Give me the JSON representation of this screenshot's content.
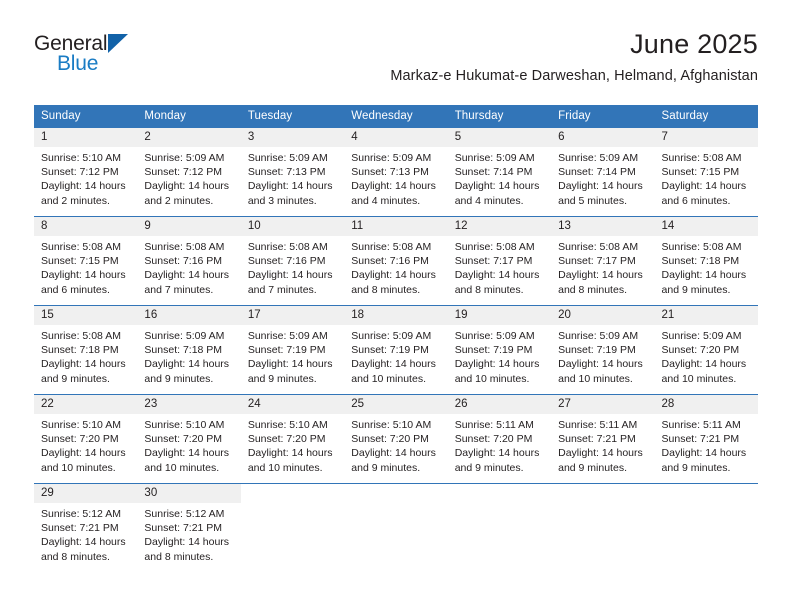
{
  "branding": {
    "logo_text_primary": "General",
    "logo_text_secondary": "Blue",
    "logo_icon": "triangle-flag-icon",
    "accent_color": "#1262a8"
  },
  "header": {
    "month_title": "June 2025",
    "location": "Markaz-e Hukumat-e Darweshan, Helmand, Afghanistan",
    "header_bar_color": "#3275b8",
    "daynum_band_color": "#f0f0f0"
  },
  "calendar": {
    "weekday_headers": [
      "Sunday",
      "Monday",
      "Tuesday",
      "Wednesday",
      "Thursday",
      "Friday",
      "Saturday"
    ],
    "weeks": [
      [
        {
          "day": "1",
          "sunrise": "Sunrise: 5:10 AM",
          "sunset": "Sunset: 7:12 PM",
          "daylight_line1": "Daylight: 14 hours",
          "daylight_line2": "and 2 minutes."
        },
        {
          "day": "2",
          "sunrise": "Sunrise: 5:09 AM",
          "sunset": "Sunset: 7:12 PM",
          "daylight_line1": "Daylight: 14 hours",
          "daylight_line2": "and 2 minutes."
        },
        {
          "day": "3",
          "sunrise": "Sunrise: 5:09 AM",
          "sunset": "Sunset: 7:13 PM",
          "daylight_line1": "Daylight: 14 hours",
          "daylight_line2": "and 3 minutes."
        },
        {
          "day": "4",
          "sunrise": "Sunrise: 5:09 AM",
          "sunset": "Sunset: 7:13 PM",
          "daylight_line1": "Daylight: 14 hours",
          "daylight_line2": "and 4 minutes."
        },
        {
          "day": "5",
          "sunrise": "Sunrise: 5:09 AM",
          "sunset": "Sunset: 7:14 PM",
          "daylight_line1": "Daylight: 14 hours",
          "daylight_line2": "and 4 minutes."
        },
        {
          "day": "6",
          "sunrise": "Sunrise: 5:09 AM",
          "sunset": "Sunset: 7:14 PM",
          "daylight_line1": "Daylight: 14 hours",
          "daylight_line2": "and 5 minutes."
        },
        {
          "day": "7",
          "sunrise": "Sunrise: 5:08 AM",
          "sunset": "Sunset: 7:15 PM",
          "daylight_line1": "Daylight: 14 hours",
          "daylight_line2": "and 6 minutes."
        }
      ],
      [
        {
          "day": "8",
          "sunrise": "Sunrise: 5:08 AM",
          "sunset": "Sunset: 7:15 PM",
          "daylight_line1": "Daylight: 14 hours",
          "daylight_line2": "and 6 minutes."
        },
        {
          "day": "9",
          "sunrise": "Sunrise: 5:08 AM",
          "sunset": "Sunset: 7:16 PM",
          "daylight_line1": "Daylight: 14 hours",
          "daylight_line2": "and 7 minutes."
        },
        {
          "day": "10",
          "sunrise": "Sunrise: 5:08 AM",
          "sunset": "Sunset: 7:16 PM",
          "daylight_line1": "Daylight: 14 hours",
          "daylight_line2": "and 7 minutes."
        },
        {
          "day": "11",
          "sunrise": "Sunrise: 5:08 AM",
          "sunset": "Sunset: 7:16 PM",
          "daylight_line1": "Daylight: 14 hours",
          "daylight_line2": "and 8 minutes."
        },
        {
          "day": "12",
          "sunrise": "Sunrise: 5:08 AM",
          "sunset": "Sunset: 7:17 PM",
          "daylight_line1": "Daylight: 14 hours",
          "daylight_line2": "and 8 minutes."
        },
        {
          "day": "13",
          "sunrise": "Sunrise: 5:08 AM",
          "sunset": "Sunset: 7:17 PM",
          "daylight_line1": "Daylight: 14 hours",
          "daylight_line2": "and 8 minutes."
        },
        {
          "day": "14",
          "sunrise": "Sunrise: 5:08 AM",
          "sunset": "Sunset: 7:18 PM",
          "daylight_line1": "Daylight: 14 hours",
          "daylight_line2": "and 9 minutes."
        }
      ],
      [
        {
          "day": "15",
          "sunrise": "Sunrise: 5:08 AM",
          "sunset": "Sunset: 7:18 PM",
          "daylight_line1": "Daylight: 14 hours",
          "daylight_line2": "and 9 minutes."
        },
        {
          "day": "16",
          "sunrise": "Sunrise: 5:09 AM",
          "sunset": "Sunset: 7:18 PM",
          "daylight_line1": "Daylight: 14 hours",
          "daylight_line2": "and 9 minutes."
        },
        {
          "day": "17",
          "sunrise": "Sunrise: 5:09 AM",
          "sunset": "Sunset: 7:19 PM",
          "daylight_line1": "Daylight: 14 hours",
          "daylight_line2": "and 9 minutes."
        },
        {
          "day": "18",
          "sunrise": "Sunrise: 5:09 AM",
          "sunset": "Sunset: 7:19 PM",
          "daylight_line1": "Daylight: 14 hours",
          "daylight_line2": "and 10 minutes."
        },
        {
          "day": "19",
          "sunrise": "Sunrise: 5:09 AM",
          "sunset": "Sunset: 7:19 PM",
          "daylight_line1": "Daylight: 14 hours",
          "daylight_line2": "and 10 minutes."
        },
        {
          "day": "20",
          "sunrise": "Sunrise: 5:09 AM",
          "sunset": "Sunset: 7:19 PM",
          "daylight_line1": "Daylight: 14 hours",
          "daylight_line2": "and 10 minutes."
        },
        {
          "day": "21",
          "sunrise": "Sunrise: 5:09 AM",
          "sunset": "Sunset: 7:20 PM",
          "daylight_line1": "Daylight: 14 hours",
          "daylight_line2": "and 10 minutes."
        }
      ],
      [
        {
          "day": "22",
          "sunrise": "Sunrise: 5:10 AM",
          "sunset": "Sunset: 7:20 PM",
          "daylight_line1": "Daylight: 14 hours",
          "daylight_line2": "and 10 minutes."
        },
        {
          "day": "23",
          "sunrise": "Sunrise: 5:10 AM",
          "sunset": "Sunset: 7:20 PM",
          "daylight_line1": "Daylight: 14 hours",
          "daylight_line2": "and 10 minutes."
        },
        {
          "day": "24",
          "sunrise": "Sunrise: 5:10 AM",
          "sunset": "Sunset: 7:20 PM",
          "daylight_line1": "Daylight: 14 hours",
          "daylight_line2": "and 10 minutes."
        },
        {
          "day": "25",
          "sunrise": "Sunrise: 5:10 AM",
          "sunset": "Sunset: 7:20 PM",
          "daylight_line1": "Daylight: 14 hours",
          "daylight_line2": "and 9 minutes."
        },
        {
          "day": "26",
          "sunrise": "Sunrise: 5:11 AM",
          "sunset": "Sunset: 7:20 PM",
          "daylight_line1": "Daylight: 14 hours",
          "daylight_line2": "and 9 minutes."
        },
        {
          "day": "27",
          "sunrise": "Sunrise: 5:11 AM",
          "sunset": "Sunset: 7:21 PM",
          "daylight_line1": "Daylight: 14 hours",
          "daylight_line2": "and 9 minutes."
        },
        {
          "day": "28",
          "sunrise": "Sunrise: 5:11 AM",
          "sunset": "Sunset: 7:21 PM",
          "daylight_line1": "Daylight: 14 hours",
          "daylight_line2": "and 9 minutes."
        }
      ],
      [
        {
          "day": "29",
          "sunrise": "Sunrise: 5:12 AM",
          "sunset": "Sunset: 7:21 PM",
          "daylight_line1": "Daylight: 14 hours",
          "daylight_line2": "and 8 minutes."
        },
        {
          "day": "30",
          "sunrise": "Sunrise: 5:12 AM",
          "sunset": "Sunset: 7:21 PM",
          "daylight_line1": "Daylight: 14 hours",
          "daylight_line2": "and 8 minutes."
        },
        {
          "day": "",
          "sunrise": "",
          "sunset": "",
          "daylight_line1": "",
          "daylight_line2": ""
        },
        {
          "day": "",
          "sunrise": "",
          "sunset": "",
          "daylight_line1": "",
          "daylight_line2": ""
        },
        {
          "day": "",
          "sunrise": "",
          "sunset": "",
          "daylight_line1": "",
          "daylight_line2": ""
        },
        {
          "day": "",
          "sunrise": "",
          "sunset": "",
          "daylight_line1": "",
          "daylight_line2": ""
        },
        {
          "day": "",
          "sunrise": "",
          "sunset": "",
          "daylight_line1": "",
          "daylight_line2": ""
        }
      ]
    ]
  }
}
